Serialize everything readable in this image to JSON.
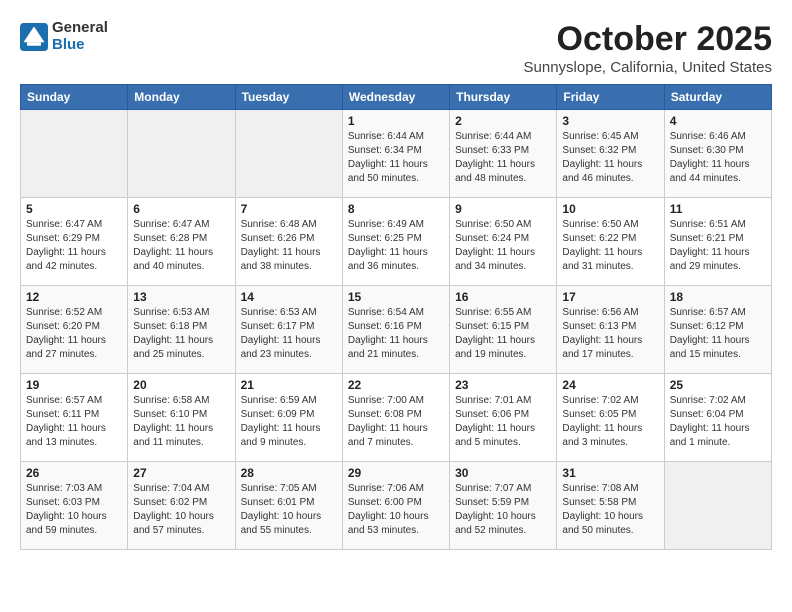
{
  "header": {
    "logo_general": "General",
    "logo_blue": "Blue",
    "month": "October 2025",
    "location": "Sunnyslope, California, United States"
  },
  "weekdays": [
    "Sunday",
    "Monday",
    "Tuesday",
    "Wednesday",
    "Thursday",
    "Friday",
    "Saturday"
  ],
  "weeks": [
    [
      {
        "day": "",
        "info": ""
      },
      {
        "day": "",
        "info": ""
      },
      {
        "day": "",
        "info": ""
      },
      {
        "day": "1",
        "info": "Sunrise: 6:44 AM\nSunset: 6:34 PM\nDaylight: 11 hours\nand 50 minutes."
      },
      {
        "day": "2",
        "info": "Sunrise: 6:44 AM\nSunset: 6:33 PM\nDaylight: 11 hours\nand 48 minutes."
      },
      {
        "day": "3",
        "info": "Sunrise: 6:45 AM\nSunset: 6:32 PM\nDaylight: 11 hours\nand 46 minutes."
      },
      {
        "day": "4",
        "info": "Sunrise: 6:46 AM\nSunset: 6:30 PM\nDaylight: 11 hours\nand 44 minutes."
      }
    ],
    [
      {
        "day": "5",
        "info": "Sunrise: 6:47 AM\nSunset: 6:29 PM\nDaylight: 11 hours\nand 42 minutes."
      },
      {
        "day": "6",
        "info": "Sunrise: 6:47 AM\nSunset: 6:28 PM\nDaylight: 11 hours\nand 40 minutes."
      },
      {
        "day": "7",
        "info": "Sunrise: 6:48 AM\nSunset: 6:26 PM\nDaylight: 11 hours\nand 38 minutes."
      },
      {
        "day": "8",
        "info": "Sunrise: 6:49 AM\nSunset: 6:25 PM\nDaylight: 11 hours\nand 36 minutes."
      },
      {
        "day": "9",
        "info": "Sunrise: 6:50 AM\nSunset: 6:24 PM\nDaylight: 11 hours\nand 34 minutes."
      },
      {
        "day": "10",
        "info": "Sunrise: 6:50 AM\nSunset: 6:22 PM\nDaylight: 11 hours\nand 31 minutes."
      },
      {
        "day": "11",
        "info": "Sunrise: 6:51 AM\nSunset: 6:21 PM\nDaylight: 11 hours\nand 29 minutes."
      }
    ],
    [
      {
        "day": "12",
        "info": "Sunrise: 6:52 AM\nSunset: 6:20 PM\nDaylight: 11 hours\nand 27 minutes."
      },
      {
        "day": "13",
        "info": "Sunrise: 6:53 AM\nSunset: 6:18 PM\nDaylight: 11 hours\nand 25 minutes."
      },
      {
        "day": "14",
        "info": "Sunrise: 6:53 AM\nSunset: 6:17 PM\nDaylight: 11 hours\nand 23 minutes."
      },
      {
        "day": "15",
        "info": "Sunrise: 6:54 AM\nSunset: 6:16 PM\nDaylight: 11 hours\nand 21 minutes."
      },
      {
        "day": "16",
        "info": "Sunrise: 6:55 AM\nSunset: 6:15 PM\nDaylight: 11 hours\nand 19 minutes."
      },
      {
        "day": "17",
        "info": "Sunrise: 6:56 AM\nSunset: 6:13 PM\nDaylight: 11 hours\nand 17 minutes."
      },
      {
        "day": "18",
        "info": "Sunrise: 6:57 AM\nSunset: 6:12 PM\nDaylight: 11 hours\nand 15 minutes."
      }
    ],
    [
      {
        "day": "19",
        "info": "Sunrise: 6:57 AM\nSunset: 6:11 PM\nDaylight: 11 hours\nand 13 minutes."
      },
      {
        "day": "20",
        "info": "Sunrise: 6:58 AM\nSunset: 6:10 PM\nDaylight: 11 hours\nand 11 minutes."
      },
      {
        "day": "21",
        "info": "Sunrise: 6:59 AM\nSunset: 6:09 PM\nDaylight: 11 hours\nand 9 minutes."
      },
      {
        "day": "22",
        "info": "Sunrise: 7:00 AM\nSunset: 6:08 PM\nDaylight: 11 hours\nand 7 minutes."
      },
      {
        "day": "23",
        "info": "Sunrise: 7:01 AM\nSunset: 6:06 PM\nDaylight: 11 hours\nand 5 minutes."
      },
      {
        "day": "24",
        "info": "Sunrise: 7:02 AM\nSunset: 6:05 PM\nDaylight: 11 hours\nand 3 minutes."
      },
      {
        "day": "25",
        "info": "Sunrise: 7:02 AM\nSunset: 6:04 PM\nDaylight: 11 hours\nand 1 minute."
      }
    ],
    [
      {
        "day": "26",
        "info": "Sunrise: 7:03 AM\nSunset: 6:03 PM\nDaylight: 10 hours\nand 59 minutes."
      },
      {
        "day": "27",
        "info": "Sunrise: 7:04 AM\nSunset: 6:02 PM\nDaylight: 10 hours\nand 57 minutes."
      },
      {
        "day": "28",
        "info": "Sunrise: 7:05 AM\nSunset: 6:01 PM\nDaylight: 10 hours\nand 55 minutes."
      },
      {
        "day": "29",
        "info": "Sunrise: 7:06 AM\nSunset: 6:00 PM\nDaylight: 10 hours\nand 53 minutes."
      },
      {
        "day": "30",
        "info": "Sunrise: 7:07 AM\nSunset: 5:59 PM\nDaylight: 10 hours\nand 52 minutes."
      },
      {
        "day": "31",
        "info": "Sunrise: 7:08 AM\nSunset: 5:58 PM\nDaylight: 10 hours\nand 50 minutes."
      },
      {
        "day": "",
        "info": ""
      }
    ]
  ]
}
